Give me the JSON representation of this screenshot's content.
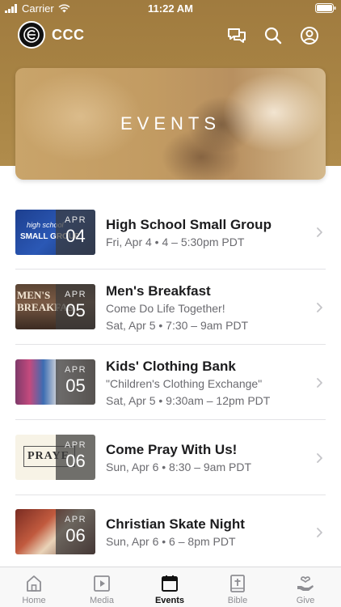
{
  "status_bar": {
    "carrier": "Carrier",
    "time": "11:22 AM"
  },
  "nav": {
    "app_title": "CCC"
  },
  "hero": {
    "title": "EVENTS"
  },
  "events": [
    {
      "title": "High School Small Group",
      "line1": "Fri, Apr 4 • 4 – 5:30pm PDT",
      "line2": "",
      "month": "APR",
      "day": "04",
      "thumb_text": [
        "high school",
        "SMALL GROUP"
      ]
    },
    {
      "title": "Men's Breakfast",
      "line1": "Come Do Life Together!",
      "line2": "Sat, Apr 5 • 7:30 – 9am PDT",
      "month": "APR",
      "day": "05",
      "thumb_text": [
        "MEN'S",
        "BREAKFAS"
      ]
    },
    {
      "title": "Kids' Clothing Bank",
      "line1": "\"Children's Clothing Exchange\"",
      "line2": "Sat, Apr 5 • 9:30am – 12pm PDT",
      "month": "APR",
      "day": "05"
    },
    {
      "title": "Come Pray With Us!",
      "line1": "Sun, Apr 6 • 8:30 – 9am PDT",
      "line2": "",
      "month": "APR",
      "day": "06",
      "thumb_text": [
        "PRAYE"
      ]
    },
    {
      "title": "Christian Skate Night",
      "line1": "Sun, Apr 6 • 6 – 8pm PDT",
      "line2": "",
      "month": "APR",
      "day": "06"
    }
  ],
  "tabs": [
    {
      "label": "Home",
      "icon": "home-icon"
    },
    {
      "label": "Media",
      "icon": "media-icon"
    },
    {
      "label": "Events",
      "icon": "calendar-icon",
      "active": true
    },
    {
      "label": "Bible",
      "icon": "bible-icon"
    },
    {
      "label": "Give",
      "icon": "give-icon"
    }
  ],
  "colors": {
    "header_gold": "#a98545",
    "text_primary": "#1c1c1e",
    "text_secondary": "#6b6b70",
    "tab_inactive": "#8e8e93"
  }
}
